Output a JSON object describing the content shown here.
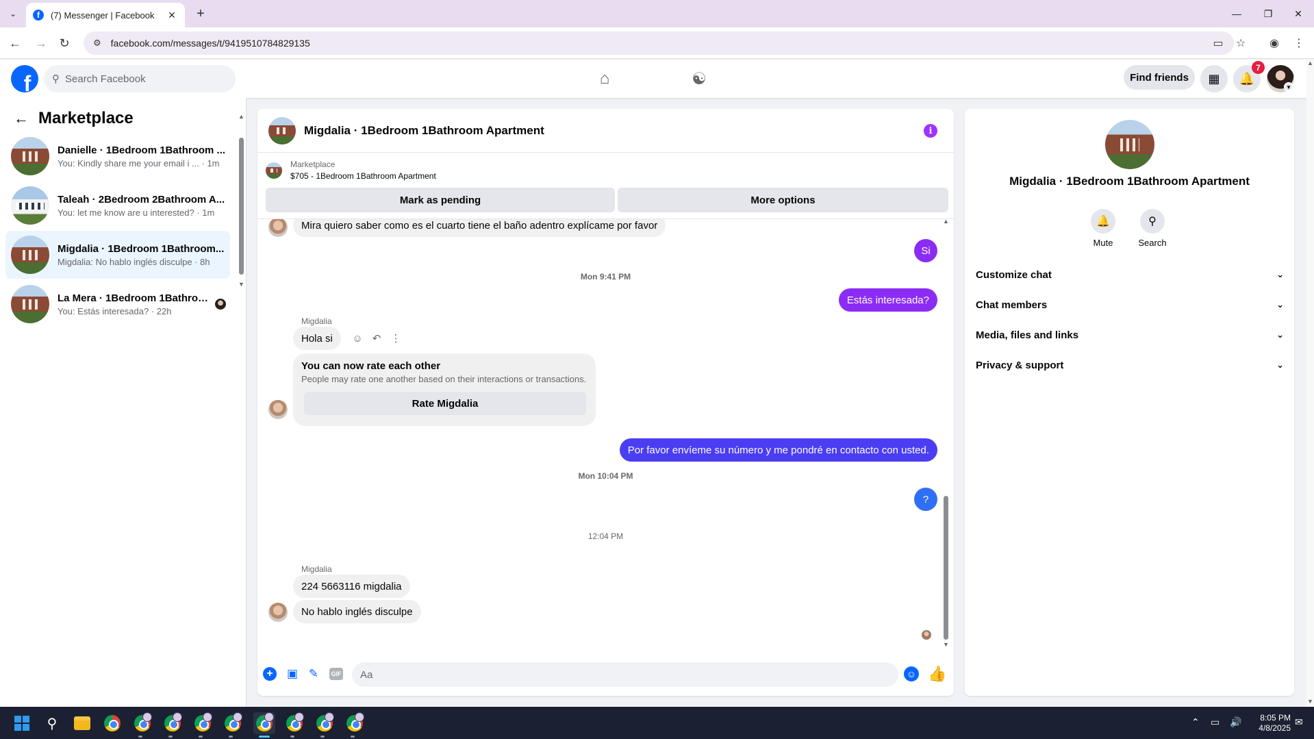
{
  "browser": {
    "tab_title": "(7) Messenger | Facebook",
    "url": "facebook.com/messages/t/9419510784829135"
  },
  "fb_header": {
    "search_placeholder": "Search Facebook",
    "find_friends_label": "Find friends",
    "notification_count": "7"
  },
  "sidebar": {
    "title": "Marketplace",
    "conversations": [
      {
        "name": "Danielle · 1Bedroom 1Bathroom ...",
        "snippet": "You: Kindly share me your email i ... · 1m"
      },
      {
        "name": "Taleah · 2Bedroom 2Bathroom A...",
        "snippet": "You: let me know are u interested? · 1m"
      },
      {
        "name": "Migdalia · 1Bedroom 1Bathroom...",
        "snippet": "Migdalia: No hablo inglés disculpe · 8h"
      },
      {
        "name": "La Mera · 1Bedroom 1Bathroo...",
        "snippet": "You: Estás interesada? · 22h"
      }
    ]
  },
  "chat": {
    "title": "Migdalia · 1Bedroom 1Bathroom Apartment",
    "listing_source": "Marketplace",
    "listing_detail": "$705 - 1Bedroom 1Bathroom Apartment",
    "mark_pending_label": "Mark as pending",
    "more_options_label": "More options",
    "messages": {
      "m1": "Mira quiero saber como es  el cuarto tiene el baño adentro  explícame por favor",
      "m2": "Si",
      "stamp1": "Mon 9:41 PM",
      "m3": "Estás interesada?",
      "sender1": "Migdalia",
      "m4": "Hola si",
      "rate_title": "You can now rate each other",
      "rate_sub": "People may rate one another based on their interactions or transactions.",
      "rate_btn": "Rate Migdalia",
      "m5": "Por favor envíeme su número y me pondré en contacto con usted.",
      "stamp2": "Mon 10:04 PM",
      "m6": "?",
      "stamp3": "12:04 PM",
      "sender2": "Migdalia",
      "m7": "224 5663116  migdalia",
      "m8": "No hablo inglés disculpe"
    },
    "composer_placeholder": "Aa"
  },
  "info_panel": {
    "title": "Migdalia · 1Bedroom 1Bathroom Apartment",
    "mute_label": "Mute",
    "search_label": "Search",
    "sections": [
      "Customize chat",
      "Chat members",
      "Media, files and links",
      "Privacy & support"
    ]
  },
  "taskbar": {
    "time": "8:05 PM",
    "date": "4/8/2025"
  },
  "colors": {
    "outgoing_purple": "#8b2cf5",
    "outgoing_blue": "#4b3df2",
    "fb_blue": "#0866ff",
    "badge_red": "#e41e3f"
  }
}
